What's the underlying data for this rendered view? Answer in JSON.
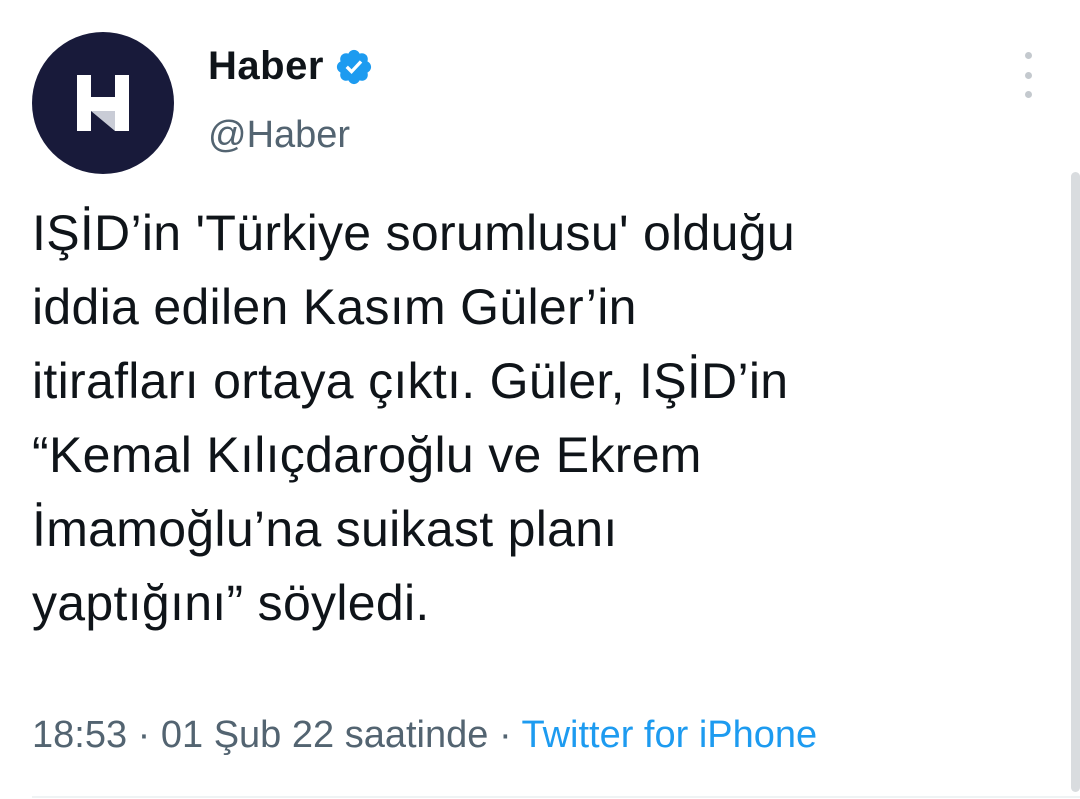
{
  "author": {
    "display_name": "Haber",
    "handle": "@Haber",
    "verified": true,
    "avatar_letter": "H",
    "avatar_bg": "#181a3a"
  },
  "icons": {
    "verified": "verified-badge-icon",
    "more": "more-options-icon"
  },
  "tweet": {
    "text": "IŞİD’in 'Türkiye sorumlusu' olduğu\niddia edilen Kasım Güler’in\nitirafları ortaya çıktı. Güler, IŞİD’in\n“Kemal Kılıçdaroğlu ve Ekrem\nİmamoğlu’na suikast planı\nyaptığını” söyledi."
  },
  "meta": {
    "time": "18:53",
    "separator": "·",
    "date": "01 Şub 22 saatinde",
    "source": "Twitter for iPhone"
  },
  "colors": {
    "text": "#0f1419",
    "secondary": "#536471",
    "link": "#1d9bf0",
    "verified": "#1d9bf0"
  }
}
